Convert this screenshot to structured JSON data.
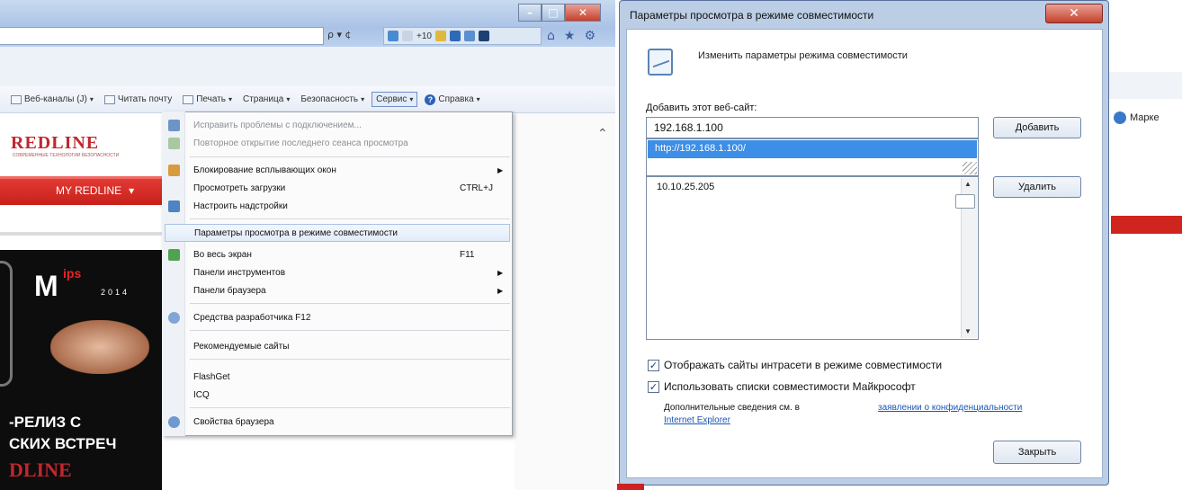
{
  "ie": {
    "address_search": "ρ ▾ ¢",
    "tab_count": "+10",
    "toolbar": {
      "feeds": "Веб-каналы (J)",
      "read_mail": "Читать почту",
      "print": "Печать",
      "page": "Страница",
      "safety": "Безопасность",
      "service": "Сервис",
      "help": "Справка"
    },
    "menu": {
      "items": [
        {
          "label": "Исправить проблемы с подключением...",
          "disabled": true
        },
        {
          "label": "Повторное открытие последнего сеанса просмотра",
          "disabled": true
        },
        {
          "label": "Блокирование всплывающих окон",
          "submenu": true
        },
        {
          "label": "Просмотреть загрузки",
          "shortcut": "CTRL+J"
        },
        {
          "label": "Настроить надстройки"
        },
        {
          "label": "Параметры просмотра в режиме совместимости",
          "highlighted": true
        },
        {
          "label": "Во весь экран",
          "shortcut": "F11"
        },
        {
          "label": "Панели инструментов",
          "submenu": true
        },
        {
          "label": "Панели браузера",
          "submenu": true
        },
        {
          "label": "Средства разработчика F12"
        },
        {
          "label": "Рекомендуемые сайты"
        },
        {
          "label": "FlashGet"
        },
        {
          "label": "ICQ"
        },
        {
          "label": "Свойства браузера"
        }
      ]
    },
    "site": {
      "logo": "REDLINE",
      "tagline": "СОВРЕМЕННЫЕ ТЕХНОЛОГИИ БЕЗОПАСНОСТИ",
      "nav": "MY REDLINE",
      "banner_brand": "M",
      "banner_ips": "ips",
      "banner_year": "2014",
      "banner_line1": "-РЕЛИЗ С",
      "banner_line2": "СКИХ ВСТРЕЧ",
      "banner_line3": "DLINE"
    }
  },
  "dialog": {
    "title": "Параметры просмотра в режиме совместимости",
    "close_glyph": "✕",
    "heading": "Изменить параметры режима совместимости",
    "add_label": "Добавить этот веб-сайт:",
    "site_input_value": "192.168.1.100",
    "suggestion": "http://192.168.1.100/",
    "add_button": "Добавить",
    "sites": [
      "10.10.25.205"
    ],
    "delete_button": "Удалить",
    "checkbox1": {
      "label": "Отображать сайты интрасети в режиме совместимости",
      "checked": true
    },
    "checkbox2": {
      "label": "Использовать списки совместимости Майкрософт",
      "checked": true
    },
    "more_info": "Дополнительные сведения см. в",
    "more_link": "заявлении о конфиденциальности",
    "more_link2": "Internet Explorer",
    "close_button": "Закрыть"
  },
  "background": {
    "favorites_label": "Марке"
  },
  "colors": {
    "brand_red": "#c1272d",
    "highlight_blue": "#3c8ee6",
    "link_blue": "#1a56b7"
  }
}
